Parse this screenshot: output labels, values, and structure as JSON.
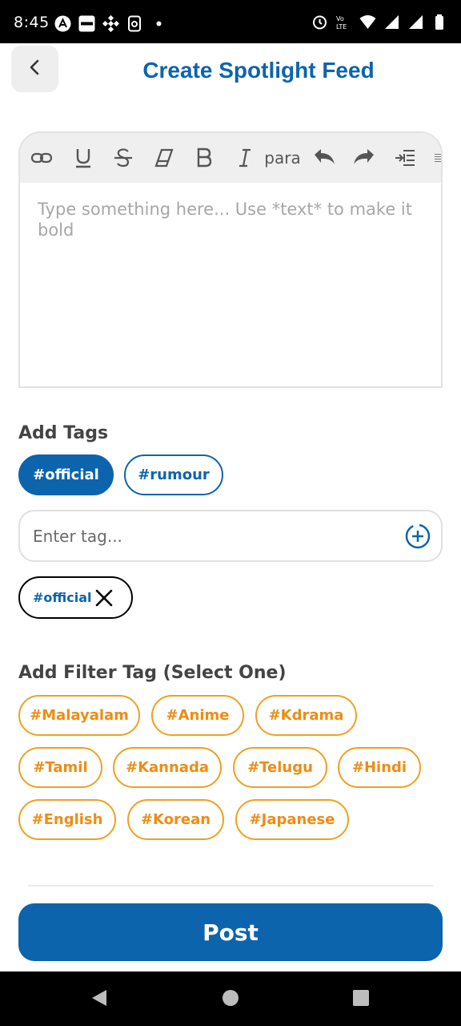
{
  "status_bar": {
    "time": "8:45",
    "left_icons": [
      "app-a-icon",
      "blinkit-icon",
      "binance-icon",
      "phonepe-icon",
      "dot-icon"
    ],
    "right_icons": [
      "alarm-icon",
      "volte-icon",
      "wifi-icon",
      "signal-icon",
      "signal-icon",
      "battery-icon"
    ]
  },
  "header": {
    "title": "Create Spotlight Feed",
    "back_icon": "chevron-left-icon"
  },
  "editor": {
    "toolbar": [
      "link-icon",
      "underline-icon",
      "strikethrough-icon",
      "eraser-icon",
      "bold-icon",
      "italic-icon",
      "para",
      "undo-icon",
      "redo-icon",
      "indent-icon",
      "align-icon"
    ],
    "para_label": "para",
    "placeholder": "Type something here... Use *text* to make it bold"
  },
  "tags": {
    "title": "Add Tags",
    "options": [
      {
        "label": "#official",
        "selected": true
      },
      {
        "label": "#rumour",
        "selected": false
      }
    ],
    "input_placeholder": "Enter tag...",
    "add_icon": "add-circle-icon",
    "selected": [
      {
        "label": "#official"
      }
    ]
  },
  "filter": {
    "title": "Add Filter Tag (Select One)",
    "options": [
      "#Malayalam",
      "#Anime",
      "#Kdrama",
      "#Tamil",
      "#Kannada",
      "#Telugu",
      "#Hindi",
      "#English",
      "#Korean",
      "#Japanese"
    ]
  },
  "post_label": "Post",
  "colors": {
    "primary": "#0c64ad",
    "filter_accent": "#ef8c14",
    "filter_border": "#f1a01f"
  },
  "nav": [
    "back-triangle-icon",
    "home-circle-icon",
    "recents-square-icon"
  ]
}
